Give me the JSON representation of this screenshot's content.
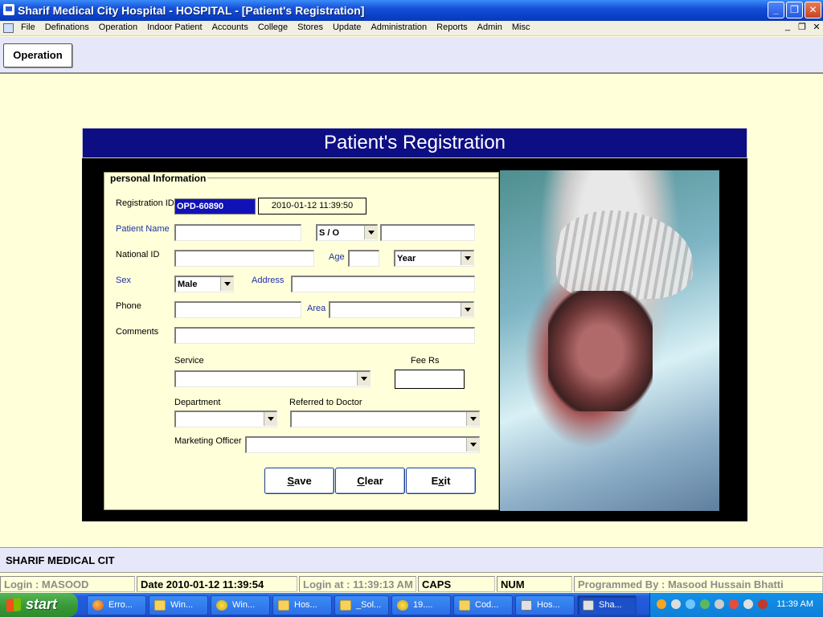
{
  "window": {
    "title": "Sharif Medical City Hospital - HOSPITAL - [Patient's Registration]"
  },
  "menu": [
    "File",
    "Definations",
    "Operation",
    "Indoor Patient",
    "Accounts",
    "College",
    "Stores",
    "Update",
    "Administration",
    "Reports",
    "Admin",
    "Misc"
  ],
  "toolbar": {
    "operation_label": "Operation"
  },
  "form": {
    "header": "Patient's Registration",
    "section_title": "personal Information",
    "registration_id_label": "Registration ID",
    "registration_id": "OPD-60890",
    "registration_datetime": "2010-01-12 11:39:50",
    "patient_name_label": "Patient Name",
    "relation_value": "S / O",
    "national_id_label": "National ID",
    "age_label": "Age",
    "age_unit": "Year",
    "sex_label": "Sex",
    "sex_value": "Male",
    "address_label": "Address",
    "phone_label": "Phone",
    "area_label": "Area",
    "comments_label": "Comments",
    "service_label": "Service",
    "fee_label": "Fee Rs",
    "department_label": "Department",
    "referred_label": "Referred to Doctor",
    "marketing_label": "Marketing Officer",
    "buttons": {
      "save_rest": "ave",
      "save_key": "S",
      "clear_rest": "lear",
      "clear_key": "C",
      "exit_rest": "it",
      "exit_key": "E",
      "exit_mid": "x"
    }
  },
  "org_strip": "SHARIF MEDICAL CIT",
  "status": {
    "login": "Login :  MASOOD",
    "date": "Date 2010-01-12 11:39:54",
    "login_at": "Login at : 11:39:13 AM",
    "caps": "CAPS",
    "num": "NUM",
    "programmer": "Programmed By : Masood Hussain Bhatti"
  },
  "taskbar": {
    "start": "start",
    "tasks": [
      "Erro...",
      "Win...",
      "Win...",
      "Hos...",
      "_Sol...",
      "19....",
      "Cod...",
      "Hos...",
      "Sha..."
    ],
    "clock": "11:39 AM"
  }
}
